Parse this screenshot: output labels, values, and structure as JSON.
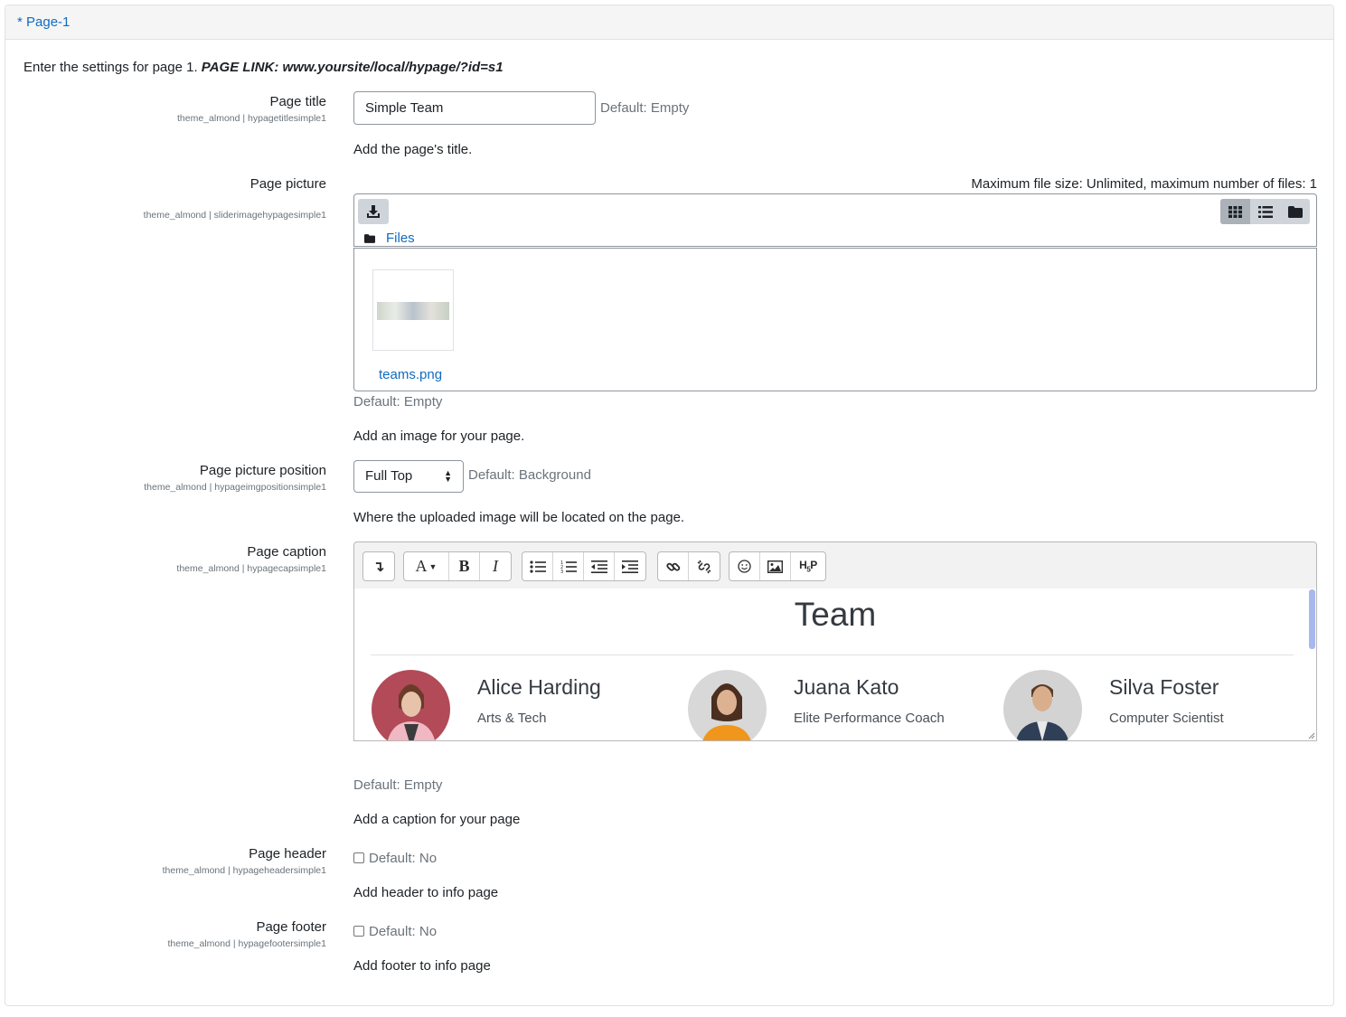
{
  "section": {
    "title": "* Page-1"
  },
  "intro": {
    "text": "Enter the settings for page 1.",
    "link_text": "PAGE LINK: www.yoursite/local/hypage/?id=s1"
  },
  "page_title": {
    "label": "Page title",
    "setting": "theme_almond | hypagetitlesimple1",
    "value": "Simple Team",
    "default": "Default: Empty",
    "description": "Add the page's title."
  },
  "page_picture": {
    "label": "Page picture",
    "setting": "theme_almond | sliderimagehypagesimple1",
    "limits": "Maximum file size: Unlimited, maximum number of files: 1",
    "breadcrumb": "Files",
    "file_name": "teams.png",
    "default": "Default: Empty",
    "description": "Add an image for your page."
  },
  "picture_position": {
    "label": "Page picture position",
    "setting": "theme_almond | hypageimgpositionsimple1",
    "selected": "Full Top",
    "default": "Default: Background",
    "description": "Where the uploaded image will be located on the page."
  },
  "caption": {
    "label": "Page caption",
    "setting": "theme_almond | hypagecapsimple1",
    "editor": {
      "heading": "Team",
      "members": [
        {
          "name": "Alice Harding",
          "role": "Arts & Tech",
          "color": "#b24a58"
        },
        {
          "name": "Juana Kato",
          "role": "Elite Performance Coach",
          "color": "#d8d8d8"
        },
        {
          "name": "Silva Foster",
          "role": "Computer Scientist",
          "color": "#d3d3d3"
        }
      ]
    },
    "default": "Default: Empty",
    "description": "Add a caption for your page"
  },
  "page_header": {
    "label": "Page header",
    "setting": "theme_almond | hypageheadersimple1",
    "checkbox_label": "Default: No",
    "description": "Add header to info page"
  },
  "page_footer": {
    "label": "Page footer",
    "setting": "theme_almond | hypagefootersimple1",
    "checkbox_label": "Default: No",
    "description": "Add footer to info page"
  },
  "colors": {
    "link": "#0f6cbf",
    "muted": "#6a737b",
    "border": "#8f959e"
  }
}
